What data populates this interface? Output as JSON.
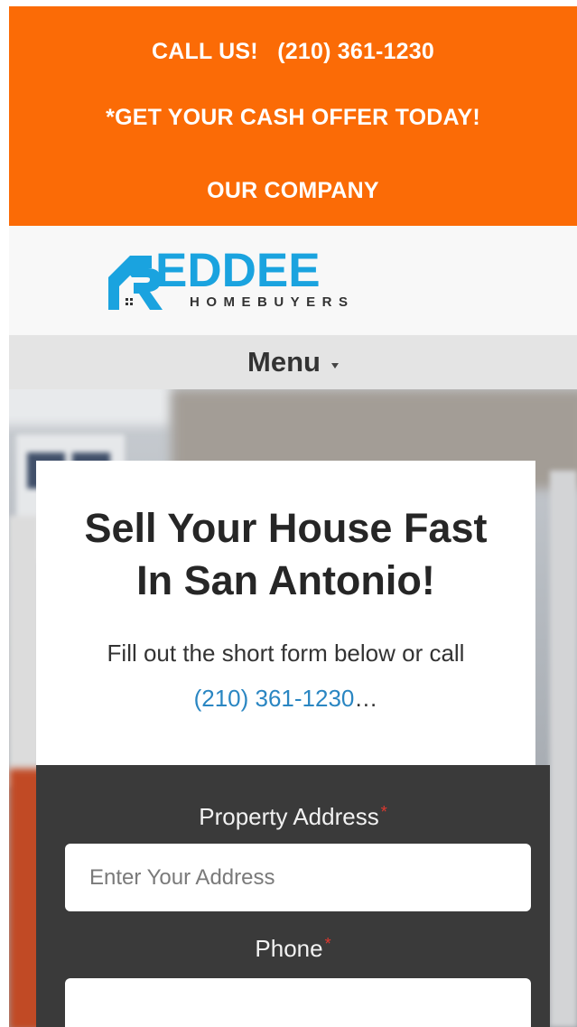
{
  "topbar": {
    "call_label": "CALL US!",
    "phone": "(210) 361-1230",
    "cash_offer": "*GET YOUR CASH OFFER TODAY!",
    "company": "OUR COMPANY"
  },
  "logo": {
    "brand": "EDDEE",
    "tagline": "HOMEBUYERS",
    "colors": {
      "brand": "#1aa3df",
      "tagline": "#333333"
    }
  },
  "menu": {
    "label": "Menu"
  },
  "hero": {
    "title_line1": "Sell Your House Fast",
    "title_line2": "In San Antonio!",
    "intro_text": "Fill out the short form below or call",
    "intro_phone": "(210) 361-1230",
    "intro_suffix": "…"
  },
  "form": {
    "address_label": "Property Address",
    "address_required": "*",
    "address_placeholder": "Enter Your Address",
    "phone_label": "Phone",
    "phone_required": "*",
    "phone_value": ""
  },
  "colors": {
    "accent": "#fb6b06",
    "link": "#2a86c2",
    "form_bg": "#3a3a3a",
    "required": "#e0382f"
  }
}
